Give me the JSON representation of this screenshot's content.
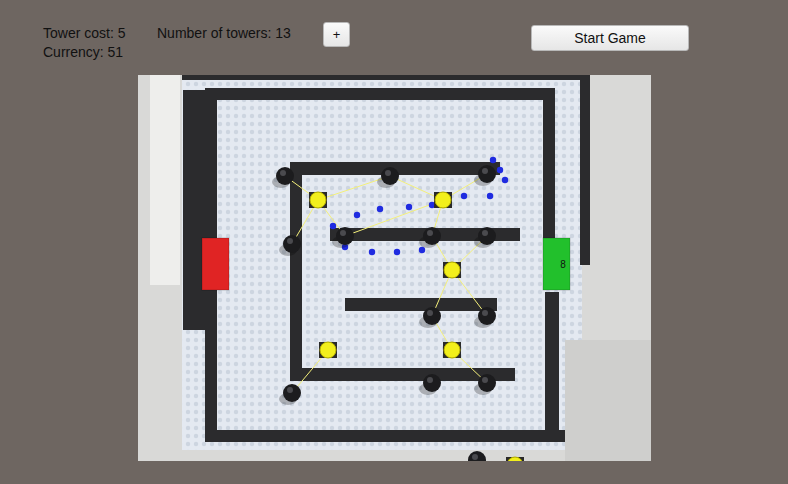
{
  "hud": {
    "tower_cost": "Tower cost: 5",
    "currency": "Currency: 51",
    "tower_count": "Number of towers: 13",
    "add_button": "+",
    "start_button": "Start Game"
  },
  "board": {
    "gates": [
      {
        "name": "spawn",
        "color": "#e02424",
        "label": ""
      },
      {
        "name": "goal",
        "color": "#22c02c",
        "label": "8"
      }
    ],
    "towers": [
      {
        "armed": false
      },
      {
        "armed": false
      },
      {
        "armed": false
      },
      {
        "armed": false
      },
      {
        "armed": false
      },
      {
        "armed": false
      },
      {
        "armed": false
      },
      {
        "armed": false
      },
      {
        "armed": false
      },
      {
        "armed": false
      },
      {
        "armed": false
      },
      {
        "armed": false
      },
      {
        "armed": false
      },
      {
        "armed": true
      },
      {
        "armed": true
      },
      {
        "armed": true
      },
      {
        "armed": true
      },
      {
        "armed": true
      },
      {
        "armed": true
      }
    ]
  }
}
